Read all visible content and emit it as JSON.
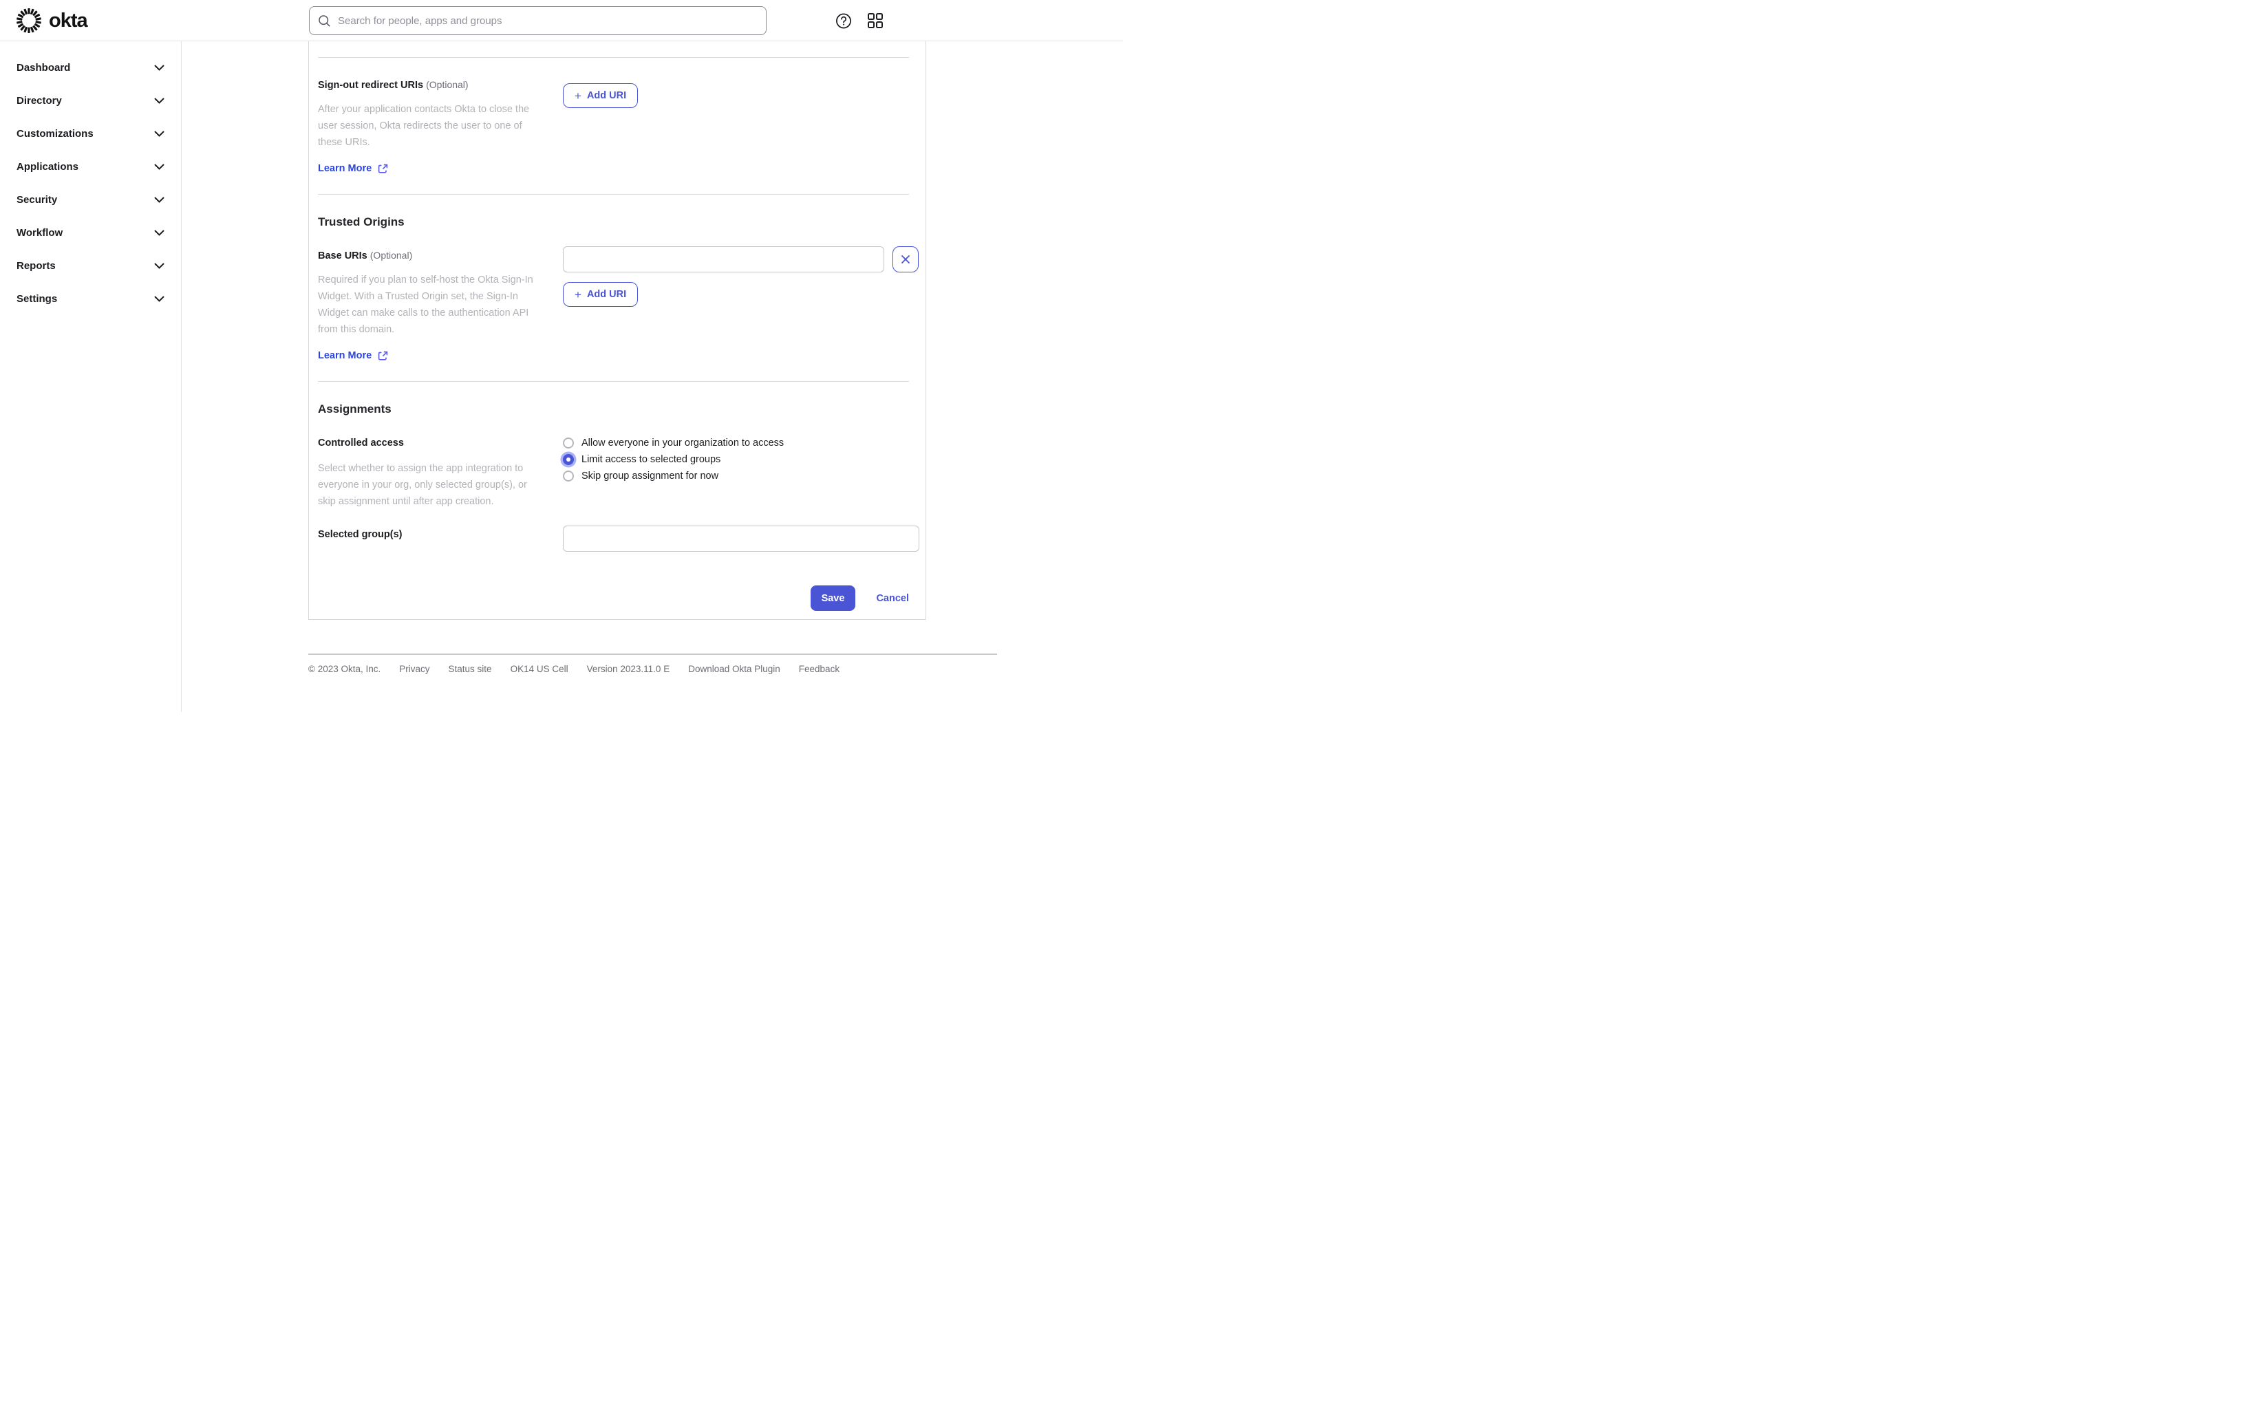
{
  "header": {
    "logo_text": "okta",
    "search_placeholder": "Search for people, apps and groups"
  },
  "icons": {
    "search": "magnifier",
    "help": "question-mark-circle",
    "apps": "grid-2x2",
    "chevron": "chevron-down",
    "external": "external-link",
    "plus": "+",
    "close": "×"
  },
  "colors": {
    "accent": "#4a55d6",
    "link": "#2b45e0",
    "selected_radio_halo": "#a9b2f4"
  },
  "sidebar": {
    "items": [
      {
        "label": "Dashboard"
      },
      {
        "label": "Directory"
      },
      {
        "label": "Customizations"
      },
      {
        "label": "Applications"
      },
      {
        "label": "Security"
      },
      {
        "label": "Workflow"
      },
      {
        "label": "Reports"
      },
      {
        "label": "Settings"
      }
    ]
  },
  "main": {
    "signout_section": {
      "label": "Sign-out redirect URIs",
      "optional": "(Optional)",
      "description": "After your application contacts Okta to close the user session, Okta redirects the user to one of these URIs.",
      "add_uri_label": "Add URI",
      "learn_more": "Learn More"
    },
    "trusted_origins": {
      "title": "Trusted Origins",
      "base_uris_label": "Base URIs",
      "optional": "(Optional)",
      "base_uri_value": "",
      "description": "Required if you plan to self-host the Okta Sign-In Widget. With a Trusted Origin set, the Sign-In Widget can make calls to the authentication API from this domain.",
      "add_uri_label": "Add URI",
      "learn_more": "Learn More"
    },
    "assignments": {
      "title": "Assignments",
      "controlled_access_label": "Controlled access",
      "options": [
        {
          "label": "Allow everyone in your organization to access",
          "selected": false
        },
        {
          "label": "Limit access to selected groups",
          "selected": true
        },
        {
          "label": "Skip group assignment for now",
          "selected": false
        }
      ],
      "description": "Select whether to assign the app integration to everyone in your org, only selected group(s), or skip assignment until after app creation.",
      "selected_groups_label": "Selected group(s)",
      "selected_groups_value": ""
    },
    "actions": {
      "save_label": "Save",
      "cancel_label": "Cancel"
    }
  },
  "footer": {
    "items": [
      "© 2023 Okta, Inc.",
      "Privacy",
      "Status site",
      "OK14 US Cell",
      "Version 2023.11.0 E",
      "Download Okta Plugin",
      "Feedback"
    ]
  }
}
